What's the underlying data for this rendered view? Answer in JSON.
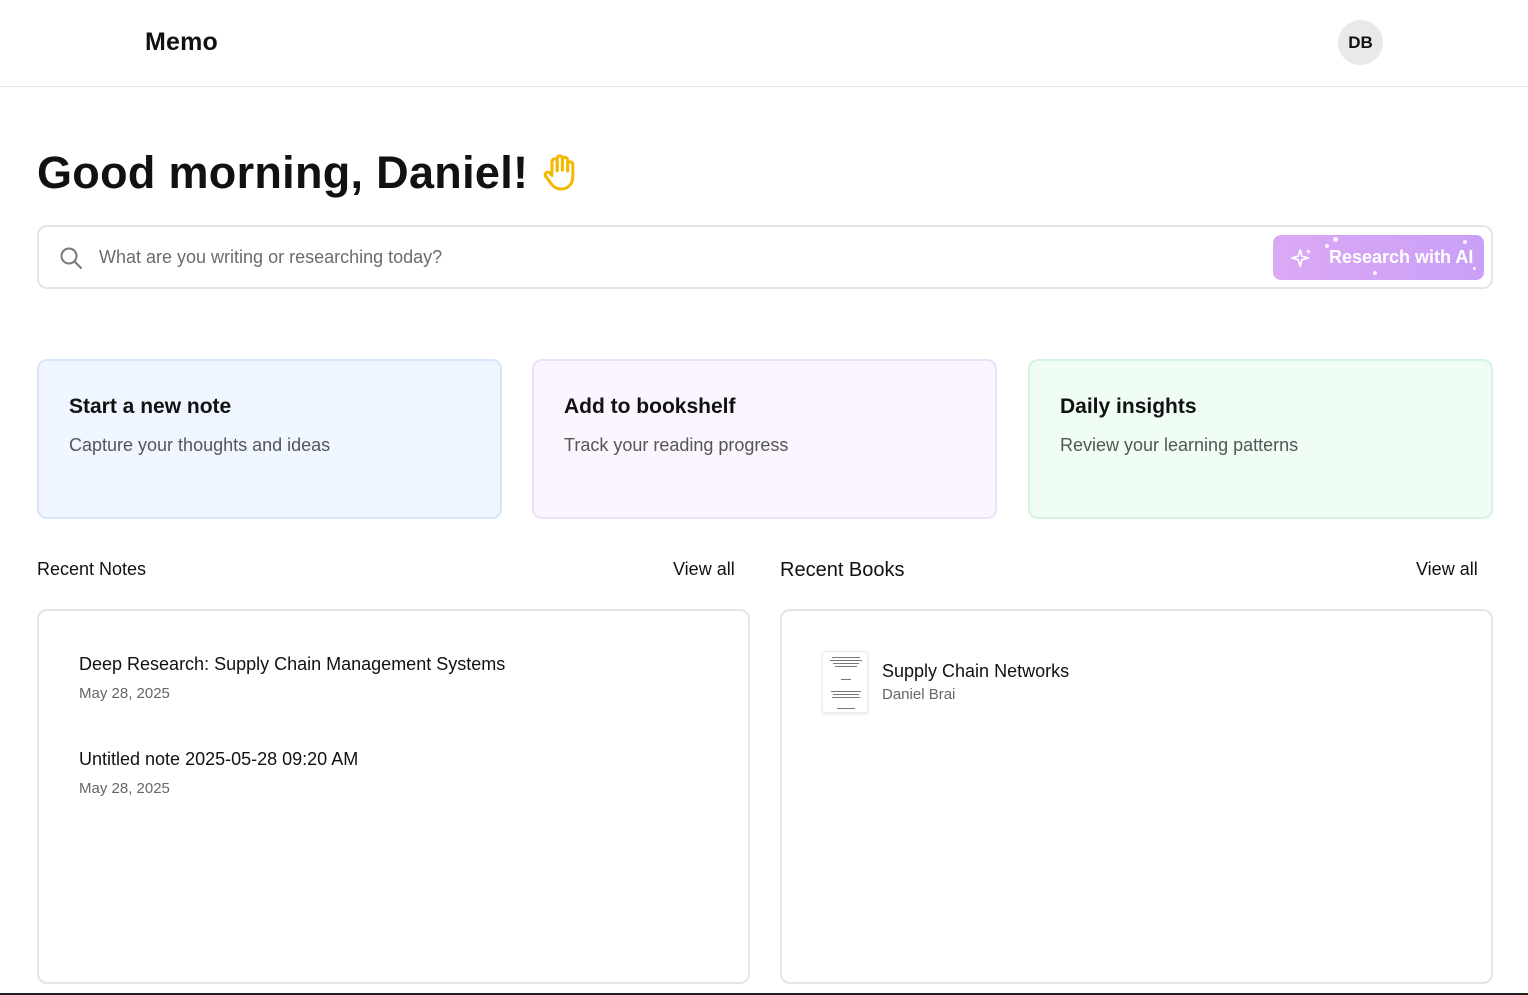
{
  "header": {
    "brand": "Memo",
    "avatar_initials": "DB"
  },
  "greeting": {
    "text": "Good morning, Daniel!",
    "icon": "waving-hand-icon"
  },
  "search": {
    "placeholder": "What are you writing or researching today?",
    "value": "",
    "ai_button_label": "Research with AI"
  },
  "quick_actions": [
    {
      "title": "Start a new note",
      "description": "Capture your thoughts and ideas"
    },
    {
      "title": "Add to bookshelf",
      "description": "Track your reading progress"
    },
    {
      "title": "Daily insights",
      "description": "Review your learning patterns"
    }
  ],
  "recent_notes": {
    "title": "Recent Notes",
    "view_all": "View all",
    "items": [
      {
        "title": "Deep Research: Supply Chain Management Systems",
        "date": "May 28, 2025"
      },
      {
        "title": "Untitled note 2025-05-28 09:20 AM",
        "date": "May 28, 2025"
      }
    ]
  },
  "recent_books": {
    "title": "Recent Books",
    "view_all": "View all",
    "items": [
      {
        "title": "Supply Chain Networks",
        "author": "Daniel Brai"
      }
    ]
  },
  "colors": {
    "accent_gradient_start": "#dba8f5",
    "accent_gradient_end": "#c9a0f7",
    "note_card_bg": "#eff6ff",
    "shelf_card_bg": "#faf5ff",
    "insights_card_bg": "#f0fdf4",
    "wave_icon": "#f5b800"
  }
}
